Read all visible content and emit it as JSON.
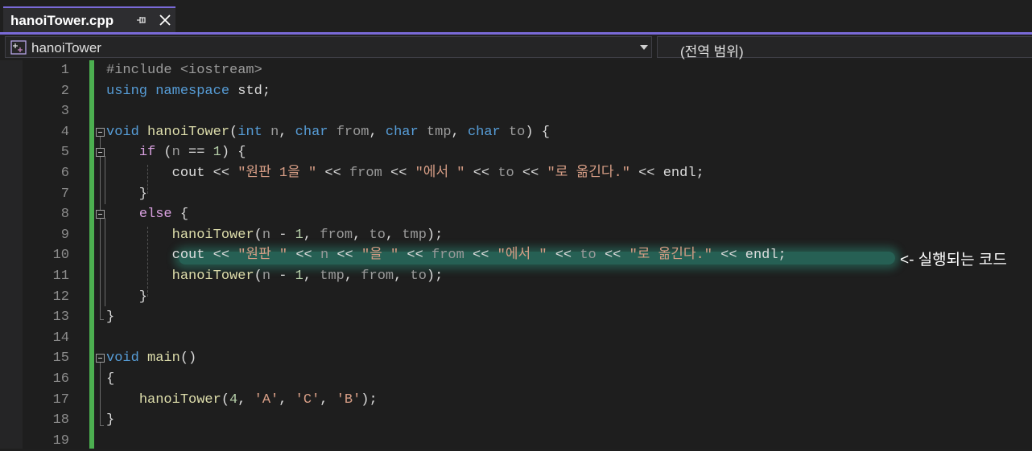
{
  "tab": {
    "title": "hanoiTower.cpp"
  },
  "nav": {
    "scope_left": "hanoiTower",
    "scope_right": "(전역 범위)"
  },
  "annotation": "<- 실행되는 코드",
  "icons": [
    "pin-icon",
    "close-icon",
    "class-icon",
    "dropdown-icon",
    "fold-icon"
  ],
  "colors": {
    "accent": "#7a6ad8",
    "change_bar": "#4caf50",
    "highlight": "#30b296"
  },
  "editor": {
    "lines": [
      {
        "n": "1",
        "t": "#include <iostream>"
      },
      {
        "n": "2",
        "t": "using namespace std;"
      },
      {
        "n": "3",
        "t": ""
      },
      {
        "n": "4",
        "t": "void hanoiTower(int n, char from, char tmp, char to) {"
      },
      {
        "n": "5",
        "t": "    if (n == 1) {"
      },
      {
        "n": "6",
        "t": "        cout << \"원판 1을 \" << from << \"에서 \" << to << \"로 옮긴다.\" << endl;"
      },
      {
        "n": "7",
        "t": "    }"
      },
      {
        "n": "8",
        "t": "    else {"
      },
      {
        "n": "9",
        "t": "        hanoiTower(n - 1, from, to, tmp);"
      },
      {
        "n": "10",
        "t": "        cout << \"원판 \" << n << \"을 \" << from << \"에서 \" << to << \"로 옮긴다.\" << endl;"
      },
      {
        "n": "11",
        "t": "        hanoiTower(n - 1, tmp, from, to);"
      },
      {
        "n": "12",
        "t": "    }"
      },
      {
        "n": "13",
        "t": "}"
      },
      {
        "n": "14",
        "t": ""
      },
      {
        "n": "15",
        "t": "void main()"
      },
      {
        "n": "16",
        "t": "{"
      },
      {
        "n": "17",
        "t": "    hanoiTower(4, 'A', 'C', 'B');"
      },
      {
        "n": "18",
        "t": "}"
      },
      {
        "n": "19",
        "t": ""
      }
    ]
  }
}
